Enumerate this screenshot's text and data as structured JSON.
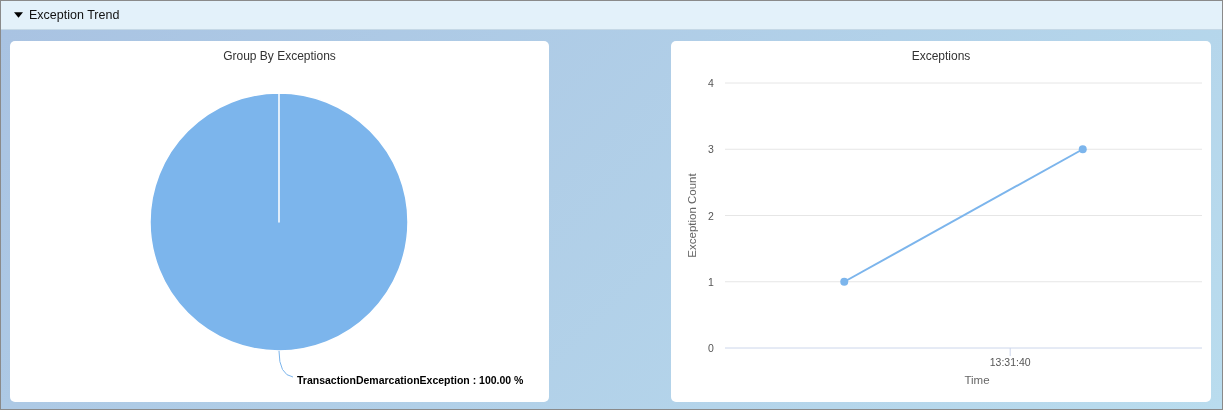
{
  "section": {
    "title": "Exception Trend",
    "expanded": true
  },
  "charts": [
    {
      "chart_data": {
        "type": "pie",
        "title": "Group By Exceptions",
        "categories": [
          "TransactionDemarcationException"
        ],
        "values": [
          100
        ],
        "colors": [
          "#7cb5ec"
        ],
        "value_labels": [
          "100.00 %"
        ]
      }
    },
    {
      "chart_data": {
        "type": "line",
        "title": "Exceptions",
        "xlabel": "Time",
        "ylabel": "Exception Count",
        "ylim": [
          0,
          4
        ],
        "yticks": [
          0,
          1,
          2,
          3,
          4
        ],
        "grid": true,
        "annotations": [
          "13:31:40"
        ],
        "series": [
          {
            "color": "#7cb5ec",
            "marker": true,
            "values": [
              1,
              3
            ]
          }
        ]
      }
    }
  ]
}
